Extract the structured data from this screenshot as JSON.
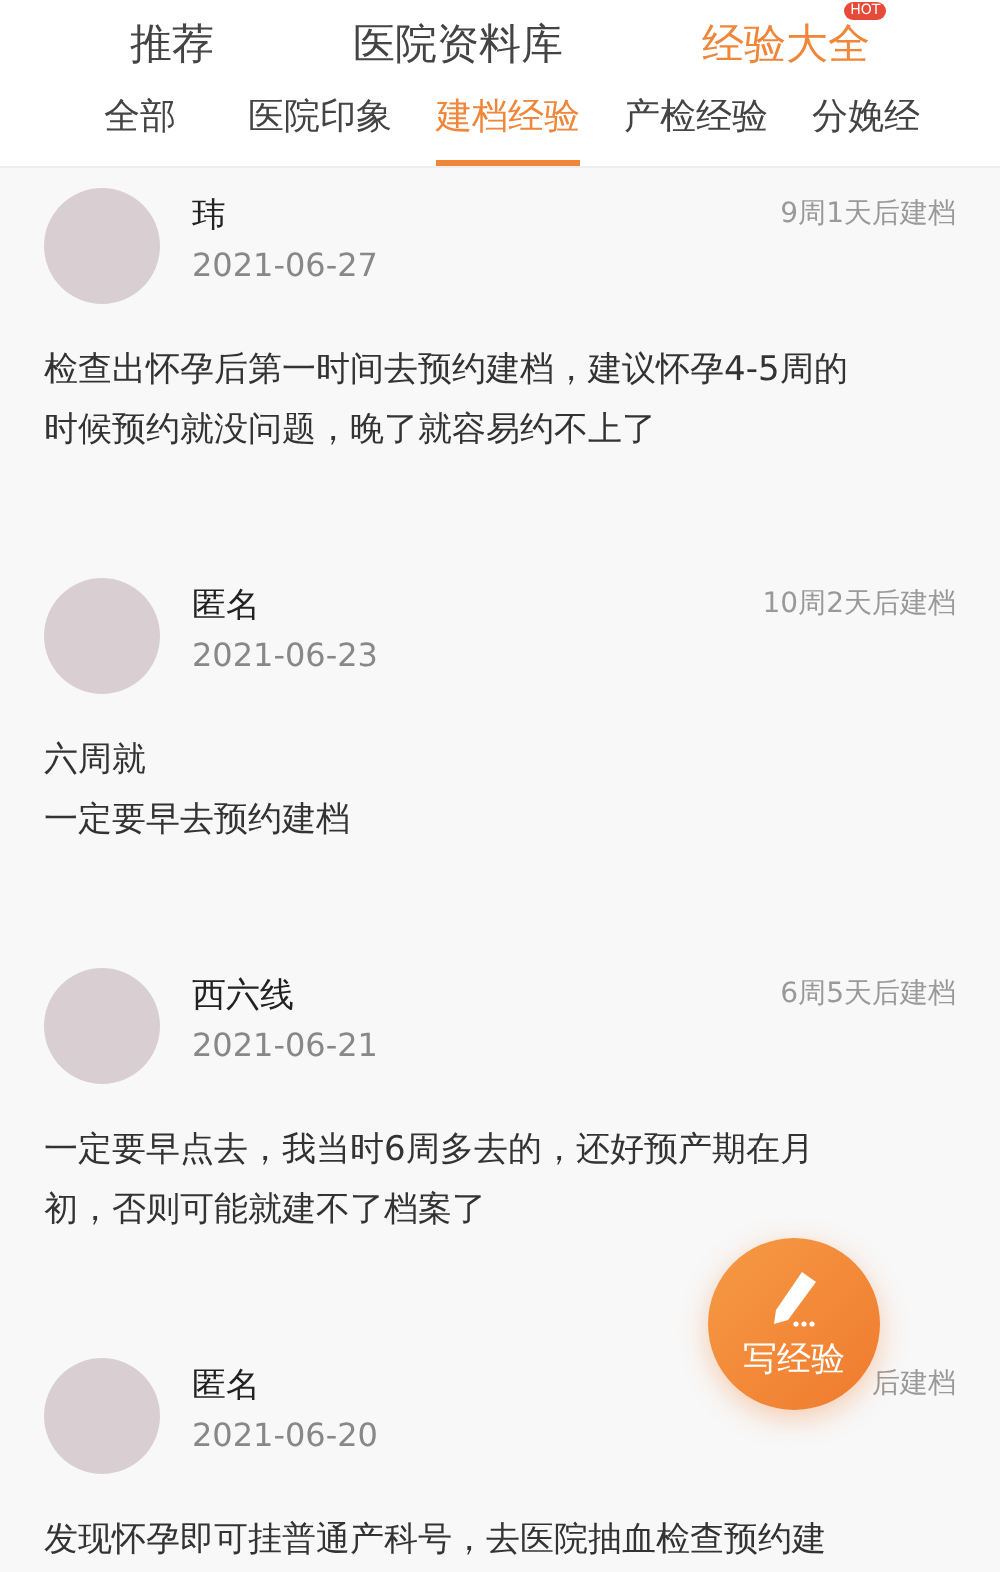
{
  "top_tabs": [
    {
      "label": "推荐",
      "selected": false
    },
    {
      "label": "医院资料库",
      "selected": false
    },
    {
      "label": "经验大全",
      "selected": true,
      "badge": "HOT"
    }
  ],
  "sub_tabs": [
    {
      "label": "全部",
      "selected": false
    },
    {
      "label": "医院印象",
      "selected": false
    },
    {
      "label": "建档经验",
      "selected": true
    },
    {
      "label": "产检经验",
      "selected": false
    },
    {
      "label": "分娩经",
      "selected": false
    }
  ],
  "posts": [
    {
      "name": "玮",
      "date": "2021-06-27",
      "tag": "9周1天后建档",
      "lines": [
        "检查出怀孕后第一时间去预约建档，建议怀孕4-5周的",
        "时候预约就没问题，晚了就容易约不上了"
      ]
    },
    {
      "name": "匿名",
      "date": "2021-06-23",
      "tag": "10周2天后建档",
      "lines": [
        "六周就",
        "一定要早去预约建档"
      ]
    },
    {
      "name": "西六线",
      "date": "2021-06-21",
      "tag": "6周5天后建档",
      "lines": [
        "一定要早点去，我当时6周多去的，还好预产期在月",
        "初，否则可能就建不了档案了"
      ]
    },
    {
      "name": "匿名",
      "date": "2021-06-20",
      "tag": "后建档",
      "lines": [
        "发现怀孕即可挂普通产科号，去医院抽血检查预约建"
      ]
    }
  ],
  "fab": {
    "label": "写经验"
  }
}
